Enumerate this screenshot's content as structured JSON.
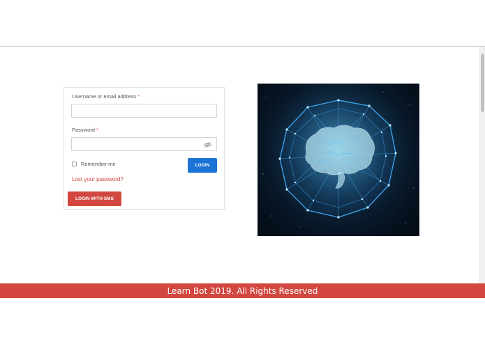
{
  "login": {
    "username_label": "Username or email address",
    "password_label": "Password",
    "required_mark": "*",
    "username_value": "",
    "password_value": "",
    "remember_label": "Remember me",
    "login_button": "LOGIN",
    "lost_password_link": "Lost your password?",
    "sms_button": "LOGIN WITH SMS"
  },
  "hero_image": {
    "subject": "glowing wireframe brain inside a network sphere"
  },
  "footer": {
    "text": "Learn Bot 2019. All Rights Reserved"
  },
  "colors": {
    "primary_blue": "#1e73d7",
    "accent_red": "#d2473f",
    "image_bg": "#0c2236"
  }
}
